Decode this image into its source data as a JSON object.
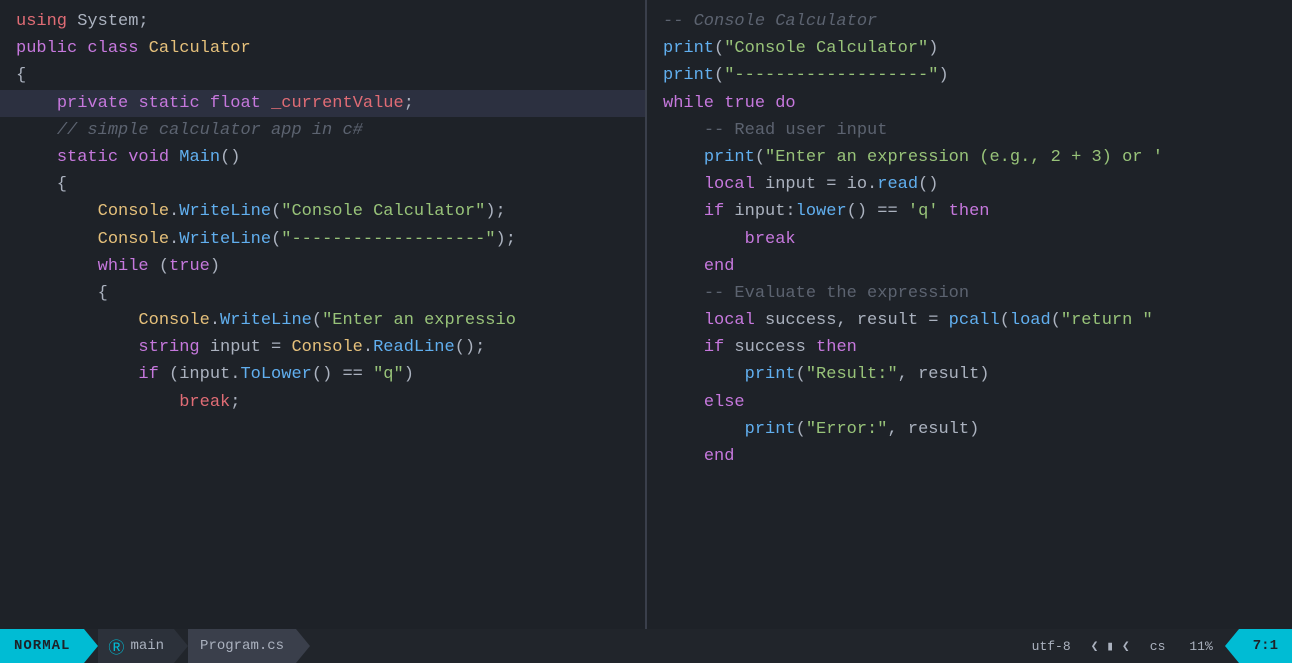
{
  "status": {
    "mode": "NORMAL",
    "branch": "main",
    "file": "Program.cs",
    "encoding": "utf-8",
    "lang": "cs",
    "percent": "11%",
    "position": "7:1"
  },
  "left_pane": {
    "lines": [
      {
        "tokens": [
          {
            "cls": "red",
            "t": "using"
          },
          {
            "cls": "plain",
            "t": " System;"
          }
        ]
      },
      {
        "tokens": [
          {
            "cls": "plain",
            "t": ""
          }
        ]
      },
      {
        "tokens": [
          {
            "cls": "kw",
            "t": "public"
          },
          {
            "cls": "plain",
            "t": " "
          },
          {
            "cls": "kw",
            "t": "class"
          },
          {
            "cls": "plain",
            "t": " "
          },
          {
            "cls": "type",
            "t": "Calculator"
          }
        ]
      },
      {
        "tokens": [
          {
            "cls": "plain",
            "t": "{"
          }
        ]
      },
      {
        "tokens": [
          {
            "cls": "plain",
            "t": "    "
          },
          {
            "cls": "kw",
            "t": "private"
          },
          {
            "cls": "plain",
            "t": " "
          },
          {
            "cls": "kw",
            "t": "static"
          },
          {
            "cls": "plain",
            "t": " "
          },
          {
            "cls": "kw",
            "t": "float"
          },
          {
            "cls": "plain",
            "t": " "
          },
          {
            "cls": "red",
            "t": "_currentValue"
          },
          {
            "cls": "plain",
            "t": ";"
          }
        ],
        "highlight": true
      },
      {
        "tokens": [
          {
            "cls": "plain",
            "t": ""
          }
        ]
      },
      {
        "tokens": [
          {
            "cls": "plain",
            "t": "    "
          },
          {
            "cls": "comment",
            "t": "// simple calculator app in c#"
          }
        ]
      },
      {
        "tokens": [
          {
            "cls": "plain",
            "t": "    "
          },
          {
            "cls": "kw",
            "t": "static"
          },
          {
            "cls": "plain",
            "t": " "
          },
          {
            "cls": "kw",
            "t": "void"
          },
          {
            "cls": "plain",
            "t": " "
          },
          {
            "cls": "fn",
            "t": "Main"
          },
          {
            "cls": "plain",
            "t": "()"
          }
        ]
      },
      {
        "tokens": [
          {
            "cls": "plain",
            "t": "    {"
          }
        ]
      },
      {
        "tokens": [
          {
            "cls": "plain",
            "t": "        "
          },
          {
            "cls": "type",
            "t": "Console"
          },
          {
            "cls": "plain",
            "t": "."
          },
          {
            "cls": "fn",
            "t": "WriteLine"
          },
          {
            "cls": "plain",
            "t": "("
          },
          {
            "cls": "str",
            "t": "\"Console Calculator\""
          },
          {
            "cls": "plain",
            "t": ");"
          }
        ]
      },
      {
        "tokens": [
          {
            "cls": "plain",
            "t": "        "
          },
          {
            "cls": "type",
            "t": "Console"
          },
          {
            "cls": "plain",
            "t": "."
          },
          {
            "cls": "fn",
            "t": "WriteLine"
          },
          {
            "cls": "plain",
            "t": "("
          },
          {
            "cls": "str",
            "t": "\"-------------------\""
          },
          {
            "cls": "plain",
            "t": ");"
          }
        ]
      },
      {
        "tokens": [
          {
            "cls": "plain",
            "t": ""
          }
        ]
      },
      {
        "tokens": [
          {
            "cls": "plain",
            "t": "        "
          },
          {
            "cls": "kw",
            "t": "while"
          },
          {
            "cls": "plain",
            "t": " ("
          },
          {
            "cls": "kw",
            "t": "true"
          },
          {
            "cls": "plain",
            "t": ")"
          }
        ]
      },
      {
        "tokens": [
          {
            "cls": "plain",
            "t": "        {"
          }
        ]
      },
      {
        "tokens": [
          {
            "cls": "plain",
            "t": "            "
          },
          {
            "cls": "type",
            "t": "Console"
          },
          {
            "cls": "plain",
            "t": "."
          },
          {
            "cls": "fn",
            "t": "WriteLine"
          },
          {
            "cls": "plain",
            "t": "("
          },
          {
            "cls": "str",
            "t": "\"Enter an expressio"
          }
        ]
      },
      {
        "tokens": [
          {
            "cls": "plain",
            "t": "            "
          },
          {
            "cls": "kw",
            "t": "string"
          },
          {
            "cls": "plain",
            "t": " input = "
          },
          {
            "cls": "type",
            "t": "Console"
          },
          {
            "cls": "plain",
            "t": "."
          },
          {
            "cls": "fn",
            "t": "ReadLine"
          },
          {
            "cls": "plain",
            "t": "();"
          }
        ]
      },
      {
        "tokens": [
          {
            "cls": "plain",
            "t": ""
          }
        ]
      },
      {
        "tokens": [
          {
            "cls": "plain",
            "t": "            "
          },
          {
            "cls": "kw",
            "t": "if"
          },
          {
            "cls": "plain",
            "t": " (input."
          },
          {
            "cls": "fn",
            "t": "ToLower"
          },
          {
            "cls": "plain",
            "t": "() == "
          },
          {
            "cls": "str",
            "t": "\"q\""
          },
          {
            "cls": "plain",
            "t": ")"
          }
        ]
      },
      {
        "tokens": [
          {
            "cls": "plain",
            "t": "                "
          },
          {
            "cls": "red",
            "t": "break"
          },
          {
            "cls": "plain",
            "t": ";"
          }
        ]
      }
    ]
  },
  "right_pane": {
    "lines": [
      {
        "tokens": [
          {
            "cls": "comment",
            "t": "-- Console Calculator"
          }
        ]
      },
      {
        "tokens": [
          {
            "cls": "lua-fn",
            "t": "print"
          },
          {
            "cls": "plain",
            "t": "("
          },
          {
            "cls": "lua-str",
            "t": "\"Console Calculator\""
          },
          {
            "cls": "plain",
            "t": ")"
          }
        ]
      },
      {
        "tokens": [
          {
            "cls": "lua-fn",
            "t": "print"
          },
          {
            "cls": "plain",
            "t": "("
          },
          {
            "cls": "lua-str",
            "t": "\"-------------------\""
          },
          {
            "cls": "plain",
            "t": ")"
          }
        ]
      },
      {
        "tokens": [
          {
            "cls": "plain",
            "t": ""
          }
        ]
      },
      {
        "tokens": [
          {
            "cls": "lua-kw",
            "t": "while"
          },
          {
            "cls": "plain",
            "t": " "
          },
          {
            "cls": "kw",
            "t": "true"
          },
          {
            "cls": "plain",
            "t": " "
          },
          {
            "cls": "lua-kw",
            "t": "do"
          }
        ]
      },
      {
        "tokens": [
          {
            "cls": "plain",
            "t": "    "
          },
          {
            "cls": "lua-comment",
            "t": "-- Read user input"
          }
        ]
      },
      {
        "tokens": [
          {
            "cls": "plain",
            "t": "    "
          },
          {
            "cls": "lua-fn",
            "t": "print"
          },
          {
            "cls": "plain",
            "t": "("
          },
          {
            "cls": "lua-str",
            "t": "\"Enter an expression (e.g., 2 + 3) or '"
          }
        ]
      },
      {
        "tokens": [
          {
            "cls": "plain",
            "t": "    "
          },
          {
            "cls": "lua-kw",
            "t": "local"
          },
          {
            "cls": "plain",
            "t": " input = io."
          },
          {
            "cls": "lua-fn",
            "t": "read"
          },
          {
            "cls": "plain",
            "t": "()"
          }
        ]
      },
      {
        "tokens": [
          {
            "cls": "plain",
            "t": ""
          }
        ]
      },
      {
        "tokens": [
          {
            "cls": "plain",
            "t": "    "
          },
          {
            "cls": "lua-kw",
            "t": "if"
          },
          {
            "cls": "plain",
            "t": " input:"
          },
          {
            "cls": "lua-fn",
            "t": "lower"
          },
          {
            "cls": "plain",
            "t": "() == "
          },
          {
            "cls": "lua-str",
            "t": "'q'"
          },
          {
            "cls": "plain",
            "t": " "
          },
          {
            "cls": "lua-kw",
            "t": "then"
          }
        ]
      },
      {
        "tokens": [
          {
            "cls": "plain",
            "t": "        "
          },
          {
            "cls": "lua-kw",
            "t": "break"
          }
        ]
      },
      {
        "tokens": [
          {
            "cls": "plain",
            "t": "    "
          },
          {
            "cls": "lua-kw",
            "t": "end"
          }
        ]
      },
      {
        "tokens": [
          {
            "cls": "plain",
            "t": ""
          }
        ]
      },
      {
        "tokens": [
          {
            "cls": "plain",
            "t": "    "
          },
          {
            "cls": "lua-comment",
            "t": "-- Evaluate the expression"
          }
        ]
      },
      {
        "tokens": [
          {
            "cls": "plain",
            "t": "    "
          },
          {
            "cls": "lua-kw",
            "t": "local"
          },
          {
            "cls": "plain",
            "t": " success, result = "
          },
          {
            "cls": "lua-fn",
            "t": "pcall"
          },
          {
            "cls": "plain",
            "t": "("
          },
          {
            "cls": "lua-fn",
            "t": "load"
          },
          {
            "cls": "plain",
            "t": "("
          },
          {
            "cls": "lua-str",
            "t": "\"return \""
          }
        ]
      },
      {
        "tokens": [
          {
            "cls": "plain",
            "t": "    "
          },
          {
            "cls": "lua-kw",
            "t": "if"
          },
          {
            "cls": "plain",
            "t": " success "
          },
          {
            "cls": "lua-kw",
            "t": "then"
          }
        ]
      },
      {
        "tokens": [
          {
            "cls": "plain",
            "t": "        "
          },
          {
            "cls": "lua-fn",
            "t": "print"
          },
          {
            "cls": "plain",
            "t": "("
          },
          {
            "cls": "lua-str",
            "t": "\"Result:\""
          },
          {
            "cls": "plain",
            "t": ", result)"
          }
        ]
      },
      {
        "tokens": [
          {
            "cls": "plain",
            "t": "    "
          },
          {
            "cls": "lua-kw",
            "t": "else"
          }
        ]
      },
      {
        "tokens": [
          {
            "cls": "plain",
            "t": "        "
          },
          {
            "cls": "lua-fn",
            "t": "print"
          },
          {
            "cls": "plain",
            "t": "("
          },
          {
            "cls": "lua-str",
            "t": "\"Error:\""
          },
          {
            "cls": "plain",
            "t": ", result)"
          }
        ]
      },
      {
        "tokens": [
          {
            "cls": "plain",
            "t": "    "
          },
          {
            "cls": "lua-kw",
            "t": "end"
          }
        ]
      }
    ]
  }
}
